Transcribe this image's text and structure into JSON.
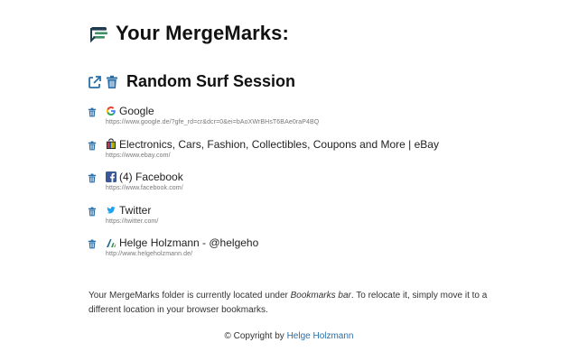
{
  "header": {
    "title": "Your MergeMarks:",
    "logo_icon": "mergemarks-logo-icon"
  },
  "session": {
    "title": "Random Surf Session",
    "open_icon": "external-link-icon",
    "delete_icon": "trash-icon"
  },
  "bookmarks": [
    {
      "title": "Google",
      "url": "https://www.google.de/?gfe_rd=cr&dcr=0&ei=bAoXWrBHsT6BAe0raP4BQ",
      "favicon": "google-favicon-icon"
    },
    {
      "title": "Electronics, Cars, Fashion, Collectibles, Coupons and More | eBay",
      "url": "https://www.ebay.com/",
      "favicon": "ebay-favicon-icon"
    },
    {
      "title": "(4) Facebook",
      "url": "https://www.facebook.com/",
      "favicon": "facebook-favicon-icon"
    },
    {
      "title": "Twitter",
      "url": "https://twitter.com/",
      "favicon": "twitter-favicon-icon"
    },
    {
      "title": "Helge Holzmann - @helgeho",
      "url": "http://www.helgeholzmann.de/",
      "favicon": "helgeholzmann-favicon-icon"
    }
  ],
  "footer": {
    "note_prefix": "Your MergeMarks folder is currently located under ",
    "note_folder": "Bookmarks bar",
    "note_suffix": ". To relocate it, simply move it to a different location in your browser bookmarks.",
    "copyright_prefix": "© Copyright by ",
    "copyright_link": "Helge Holzmann"
  },
  "colors": {
    "accent": "#2a6fa8",
    "logo_green": "#3e8e66",
    "logo_dark": "#1f3b4d",
    "facebook": "#3b5998",
    "twitter": "#1da1f2"
  }
}
